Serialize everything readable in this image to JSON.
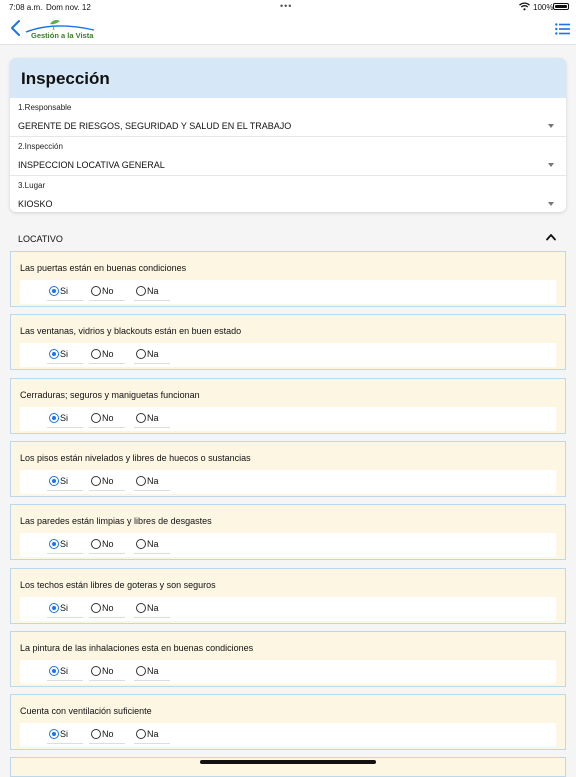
{
  "status": {
    "time": "7:08 a.m.",
    "date": "Dom nov. 12",
    "battery": "100%"
  },
  "nav": {
    "brand": "Gestión a la Vista"
  },
  "form": {
    "title": "Inspección",
    "fields": [
      {
        "label": "1.Responsable",
        "value": "GERENTE DE RIESGOS, SEGURIDAD Y SALUD EN EL TRABAJO"
      },
      {
        "label": "2.Inspección",
        "value": "INSPECCION LOCATIVA GENERAL"
      },
      {
        "label": "3.Lugar",
        "value": "KIOSKO"
      }
    ]
  },
  "section": {
    "label": "LOCATIVO"
  },
  "options": [
    "Si",
    "No",
    "Na"
  ],
  "questions": [
    {
      "text": "Las puertas están en buenas condiciones",
      "selected": "Si"
    },
    {
      "text": "Las ventanas, vidrios y blackouts están en buen estado",
      "selected": "Si"
    },
    {
      "text": "Cerraduras; seguros y maniguetas funcionan",
      "selected": "Si"
    },
    {
      "text": "Los pisos están nivelados y libres de huecos o sustancias",
      "selected": "Si"
    },
    {
      "text": "Las paredes están limpias y libres de desgastes",
      "selected": "Si"
    },
    {
      "text": "Los techos están libres de goteras y son seguros",
      "selected": "Si"
    },
    {
      "text": "La pintura de las inhalaciones esta en buenas condiciones",
      "selected": "Si"
    },
    {
      "text": "Cuenta con ventilación suficiente",
      "selected": "Si"
    }
  ],
  "colors": {
    "accent": "#1a73e8",
    "header_bg": "#d6e8f7",
    "question_bg": "#fdf6e3",
    "brand": "#3a7d2c"
  }
}
